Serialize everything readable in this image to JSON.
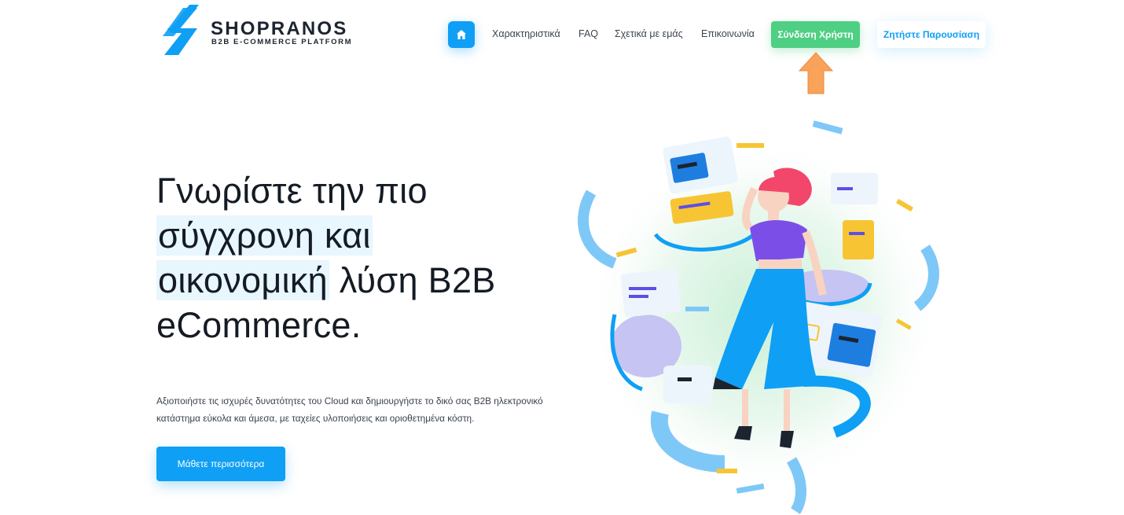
{
  "brand": {
    "name": "SHOPRANOS",
    "tagline": "B2B E-COMMERCE PLATFORM"
  },
  "nav": {
    "home_icon": "home-icon",
    "links": [
      "Χαρακτηριστικά",
      "FAQ",
      "Σχετικά με εμάς",
      "Επικοινωνία"
    ],
    "login_label": "Σύνδεση Χρήστη",
    "demo_label": "Ζητήστε Παρουσίαση"
  },
  "hero": {
    "title_lines": [
      "Γνωρίστε την πιο",
      "σύγχρονη και",
      "οικονομική",
      "λύση B2B",
      "eCommerce."
    ],
    "text_lines": [
      "Αξιοποιήστε τις ισχυρές δυνατότητες του Cloud και δημιουργήστε το δικό σας B2B ηλεκτρονικό",
      "κατάστημα εύκολα και άμεσα, με ταχείες υλοποιήσεις και οριοθετημένα κόστη."
    ],
    "cta_label": "Μάθετε περισσότερα"
  },
  "annotation": {
    "arrow_icon": "arrow-up-icon",
    "arrow_color": "#f9a25a"
  },
  "colors": {
    "primary": "#0f9ff5",
    "login": "#4fcf83",
    "logo": "#0f9ff5",
    "highlight": "#e8f6fd"
  }
}
